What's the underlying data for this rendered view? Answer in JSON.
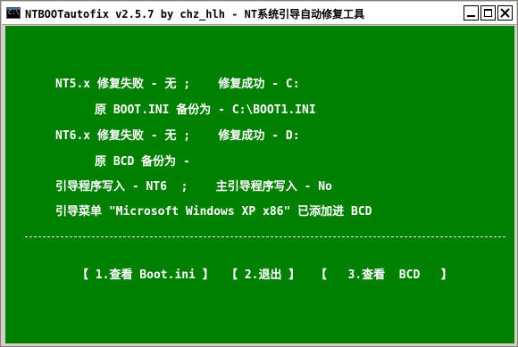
{
  "window": {
    "app_icon_text": "C:\\",
    "title": "NTBOOTautofix v2.5.7 by chz_hlh - NT系统引导自动修复工具",
    "icons": {
      "minimize": "minimize-icon",
      "maximize": "maximize-icon",
      "close": "close-icon"
    }
  },
  "console": {
    "lines": [
      "NT5.x 修复失败 - 无 ;    修复成功 - C:",
      "原 BOOT.INI 备份为 - C:\\BOOT1.INI",
      "NT6.x 修复失败 - 无 ;    修复成功 - D:",
      "原 BCD 备份为 -",
      "引导程序写入 - NT6  ;    主引导程序写入 - No",
      "引导菜单 \"Microsoft Windows XP x86\" 已添加进 BCD"
    ],
    "menu": [
      "【 1.查看 Boot.ini 】",
      "【 2.退出 】",
      "【   3.查看  BCD   】"
    ]
  },
  "colors": {
    "console_bg": "#008000",
    "console_fg": "#ffffff",
    "titlebar_bg": "#ffffff"
  }
}
